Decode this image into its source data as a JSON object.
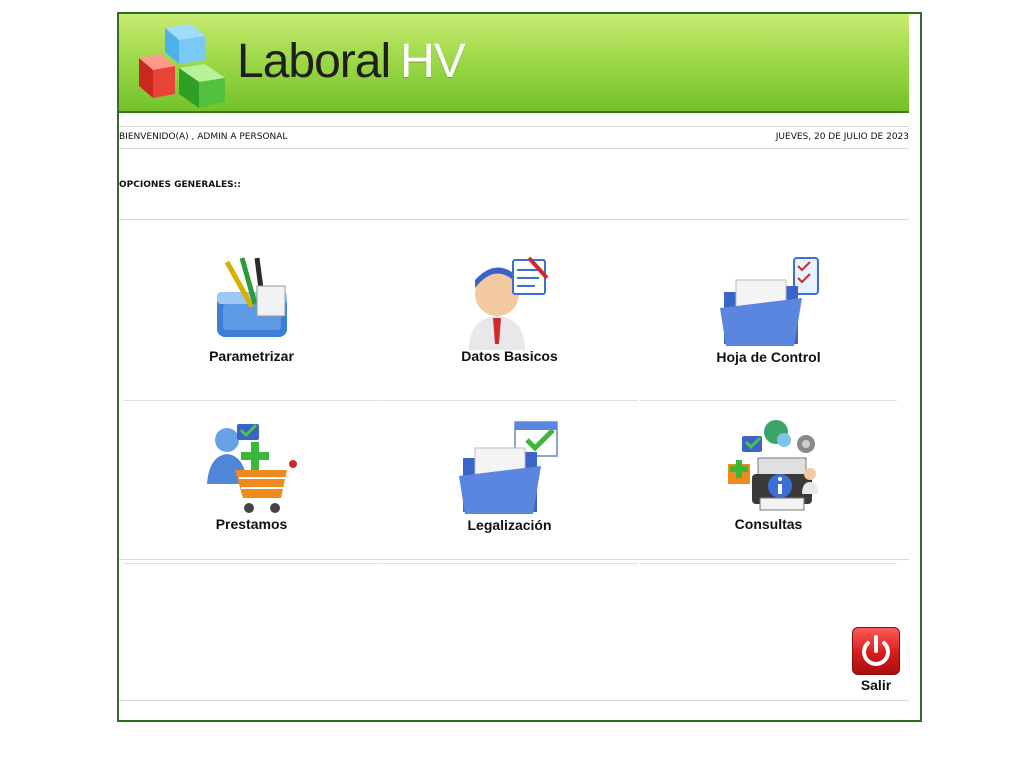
{
  "app": {
    "title_main": "Laboral",
    "title_accent": "HV"
  },
  "header": {
    "welcome_text": "BIENVENIDO(A) , ADMIN A PERSONAL",
    "date_text": "JUEVES, 20 DE JULIO DE 2023"
  },
  "section": {
    "title": "OPCIONES GENERALES::"
  },
  "menu": [
    {
      "label": "Parametrizar",
      "icon": "baskets-pencils-icon"
    },
    {
      "label": "Datos Basicos",
      "icon": "user-document-icon"
    },
    {
      "label": "Hoja de Control",
      "icon": "folder-checklist-icon"
    },
    {
      "label": "Prestamos",
      "icon": "user-cart-add-icon"
    },
    {
      "label": "Legalización",
      "icon": "folder-calendar-check-icon"
    },
    {
      "label": "Consultas",
      "icon": "printer-info-icon"
    }
  ],
  "footer": {
    "exit_label": "Salir"
  },
  "colors": {
    "banner_light": "#c9ea72",
    "banner_dark": "#74c22a",
    "frame_border": "#2f6f1f",
    "exit_red": "#d81b1b"
  }
}
